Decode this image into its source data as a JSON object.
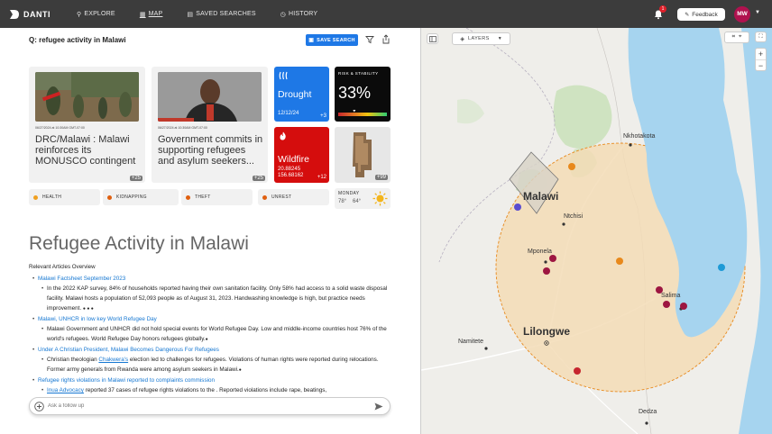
{
  "header": {
    "brand": "DANTI",
    "nav": [
      {
        "label": "EXPLORE",
        "icon": "search-icon"
      },
      {
        "label": "MAP",
        "icon": "map-icon",
        "active": true
      },
      {
        "label": "SAVED SEARCHES",
        "icon": "saved-icon"
      },
      {
        "label": "HISTORY",
        "icon": "history-icon"
      }
    ],
    "notification_count": "1",
    "feedback_label": "Feedback",
    "user_initials": "MW"
  },
  "query": {
    "text": "Q: refugee activity in Malawi",
    "save_label": "SAVE SEARCH"
  },
  "cards": {
    "news1": {
      "timestamp": "06/27/2024 at 10:30AM GMT-07:00",
      "title": "DRC/Malawi : Malawi reinforces its MONUSCO contingent",
      "more": "+25"
    },
    "news2": {
      "timestamp": "06/27/2024 at 10:30AM GMT-07:00",
      "title": "Government commits in supporting refugees and asylum seekers...",
      "more": "+25"
    },
    "drought": {
      "title": "Drought",
      "date": "12/12/24",
      "more": "+3"
    },
    "risk": {
      "label": "RISK & STABILITY",
      "value": "33%"
    },
    "wildfire": {
      "title": "Wildfire",
      "lat": "20.88245",
      "lon": "156.68162",
      "more": "+12"
    },
    "imagery": {
      "more": "+99"
    }
  },
  "pills": [
    "HEALTH",
    "KIDNAPPING",
    "THEFT",
    "UNREST"
  ],
  "weather": {
    "day": "MONDAY",
    "high": "78°",
    "low": "64°"
  },
  "report": {
    "heading": "Refugee Activity in Malawi",
    "overview_label": "Relevant Articles Overview",
    "articles": [
      {
        "title": "Malawi Factsheet September 2023",
        "detail": "In the 2022 KAP survey, 84% of households reported having their own sanitation facility. Only 58% had access to a solid waste disposal facility. Malawi hosts a population of 52,093 people as of August 31, 2023. Handwashing knowledge is high, but practice needs improvement."
      },
      {
        "title": "Malawi, UNHCR in low key World Refugee Day",
        "detail": "Malawi Government and UNHCR did not hold special events for World Refugee Day. Low and middle-income countries host 76% of the world's refugees. World Refugee Day honors refugees globally."
      },
      {
        "title": "Under A Christian President, Malawi Becomes Dangerous For Refugees",
        "detail_pre": "Christian theologian ",
        "detail_link": "Chakwera's",
        "detail_post": " election led to challenges for refugees. Violations of human rights were reported during relocations. Former army generals from Rwanda were among asylum seekers in Malawi."
      },
      {
        "title": "Refugee rights violations in Malawi reported to complaints commission",
        "detail_link": "Inua Advocacy",
        "detail_post": " reported 37 cases of refugee rights violations to the . Reported violations include rape, beatings,"
      }
    ]
  },
  "ask": {
    "placeholder": "Ask a follow up"
  },
  "map": {
    "layers_label": "LAYERS",
    "labels": {
      "country": "Malawi",
      "capital": "Lilongwe",
      "nkhotakota": "Nkhotakota",
      "ntchisi": "Ntchisi",
      "mponela": "Mponela",
      "salima": "Salima",
      "namitete": "Namitete",
      "dedza": "Dedza"
    },
    "colors": {
      "lake": "#a6d4ef",
      "radius_fill": "#f3dcb6",
      "radius_border": "#e8891c",
      "marker": "#9d1641",
      "accent": "#1e78e6"
    }
  }
}
